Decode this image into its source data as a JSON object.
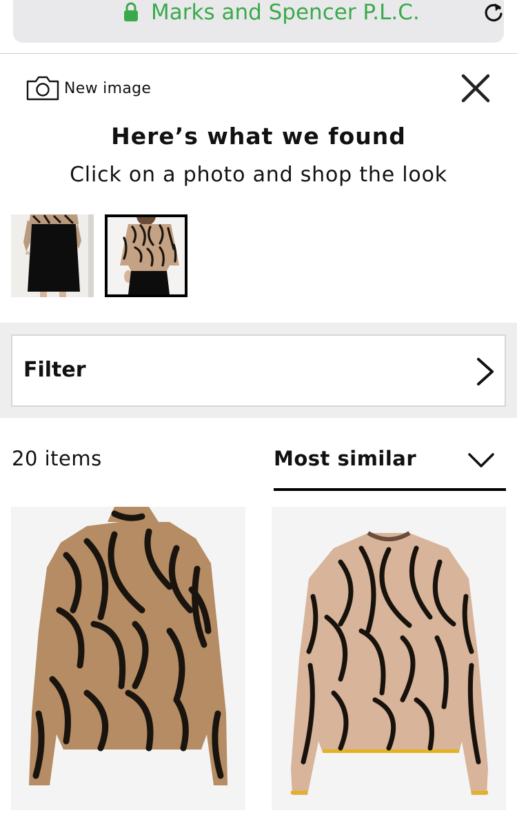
{
  "browser": {
    "url_text": "Marks and Spencer P.L.C.",
    "accent_color": "#3aa94b",
    "lock_icon": "lock-icon",
    "reload_icon": "reload-icon"
  },
  "header": {
    "new_image_label": "New image",
    "camera_icon": "camera-icon",
    "close_icon": "close-icon",
    "title": "Here’s what we found",
    "subtitle": "Click on a photo and shop the look"
  },
  "thumbnails": [
    {
      "name": "black skirt look",
      "selected": false
    },
    {
      "name": "zebra print top look",
      "selected": true
    }
  ],
  "filter": {
    "label": "Filter",
    "icon": "chevron-right-icon"
  },
  "results": {
    "count_label": "20 items",
    "sort_selected": "Most similar",
    "sort_icon": "chevron-down-icon"
  },
  "products": [
    {
      "name": "zebra print funnel neck jumper",
      "colors": [
        "#b58c63",
        "#1a140f"
      ]
    },
    {
      "name": "zebra print crew neck jumper",
      "colors": [
        "#d7b49a",
        "#18120d"
      ]
    }
  ]
}
